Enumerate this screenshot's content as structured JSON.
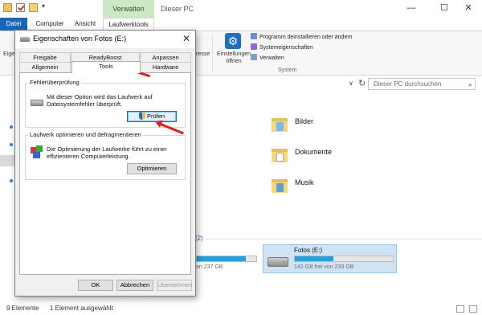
{
  "window": {
    "title": "Dieser PC",
    "context_tab": "Verwalten",
    "controls": {
      "minimize": "—",
      "maximize": "☐",
      "close": "✕"
    }
  },
  "ribbon": {
    "tabs": {
      "file": "Datei",
      "computer": "Computer",
      "view": "Ansicht",
      "drive_tools": "Laufwerktools"
    },
    "left_cut": "Eige",
    "mid_cut": "resse",
    "settings_label": "Einstellungen öffnen",
    "items": [
      "Programm deinstallieren oder ändern",
      "Systemeigenschaften",
      "Verwalten"
    ],
    "group_label": "System"
  },
  "search": {
    "placeholder": "Dieser PC durchsuchen"
  },
  "folders": [
    "Bilder",
    "Dokumente",
    "Musik"
  ],
  "drives": {
    "header_cut": "(2)",
    "left_drive": {
      "free_text": "on 237 GB",
      "fill": 0.82
    },
    "selected_drive": {
      "name": "Fotos (E:)",
      "free_text": "142 GB frei von 233 GB",
      "fill": 0.39
    }
  },
  "status": {
    "count": "9 Elemente",
    "selected": "1 Element ausgewählt"
  },
  "dialog": {
    "title": "Eigenschaften von Fotos (E:)",
    "tabs_back": [
      "Freigabe",
      "ReadyBoost",
      "Anpassen"
    ],
    "tabs_front": [
      "Allgemein",
      "Tools",
      "Hardware"
    ],
    "active_tab": "Tools",
    "error_check": {
      "title": "Fehlerüberprüfung",
      "text": "Mit dieser Option wird das Laufwerk auf Dateisystemfehler überprüft.",
      "button": "Prüfen"
    },
    "optimize": {
      "title": "Laufwerk optimieren und defragmentieren",
      "text": "Die Optimierung der Laufwerke führt zu einer effizienteren Computerleistung.",
      "button": "Optimieren"
    },
    "buttons": {
      "ok": "OK",
      "cancel": "Abbrechen",
      "apply": "Übernehmen"
    }
  },
  "colors": {
    "accent": "#1d65b5",
    "context_tab": "#cde8c4",
    "arrow": "#e21b1b",
    "drive_fill": "#26a0da"
  }
}
